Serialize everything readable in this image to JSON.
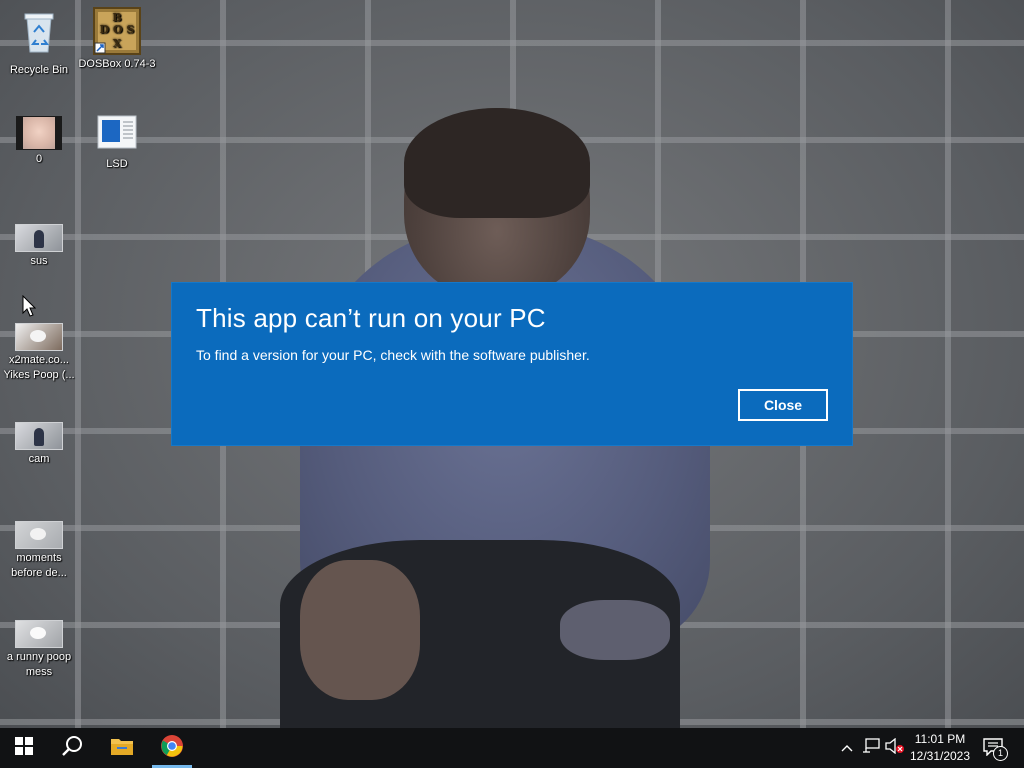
{
  "desktop": {
    "icons": [
      {
        "label": "Recycle Bin",
        "icon": "recycle-bin-icon"
      },
      {
        "label": "DOSBox 0.74-3",
        "icon": "dosbox-icon"
      },
      {
        "label": "0",
        "icon": "video-thumbnail-icon"
      },
      {
        "label": "LSD",
        "icon": "document-icon"
      },
      {
        "label": "sus",
        "icon": "video-thumbnail-icon"
      },
      {
        "label": "x2mate.co... Yikes Poop (...",
        "icon": "video-thumbnail-icon"
      },
      {
        "label": "cam",
        "icon": "video-thumbnail-icon"
      },
      {
        "label": "moments before de...",
        "icon": "video-thumbnail-icon"
      },
      {
        "label": "a runny poop mess",
        "icon": "video-thumbnail-icon"
      }
    ],
    "dosbox_tile_letters": "DOSBOX"
  },
  "dialog": {
    "title": "This app can’t run on your PC",
    "message": "To find a version for your PC, check with the software publisher.",
    "close_label": "Close",
    "background_color": "#0b6bbd"
  },
  "taskbar": {
    "items": [
      "start-icon",
      "search-icon",
      "file-explorer-icon",
      "chrome-icon"
    ],
    "tray": {
      "icons": [
        "chevron-up-icon",
        "network-icon",
        "volume-muted-icon",
        "notifications-icon"
      ],
      "time": "11:01 PM",
      "date": "12/31/2023",
      "notification_count": "1"
    }
  }
}
